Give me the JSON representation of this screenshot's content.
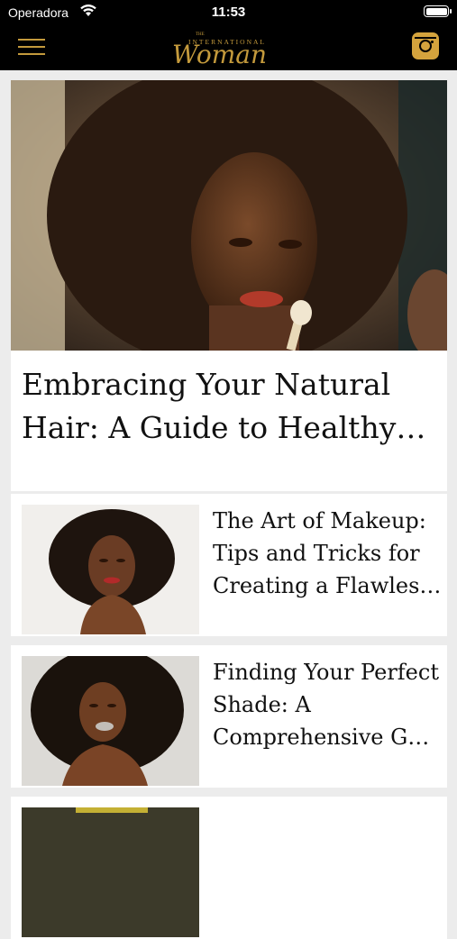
{
  "status_bar": {
    "carrier": "Operadora",
    "time": "11:53"
  },
  "nav": {
    "logo_script": "Woman",
    "logo_small_top": "THE",
    "logo_small": "INTERNATIONAL",
    "logo_color": "#c49a3c",
    "menu_icon": "hamburger-menu-icon",
    "instagram_icon": "instagram-icon"
  },
  "feed": {
    "featured": {
      "title": "Embracing Your Natural Hair: A Guide to Healthy…"
    },
    "articles": [
      {
        "title": "The Art of Makeup: Tips and Tricks for Creating a Flawles…"
      },
      {
        "title": "Finding Your Perfect Shade: A Comprehensive G…"
      }
    ]
  }
}
